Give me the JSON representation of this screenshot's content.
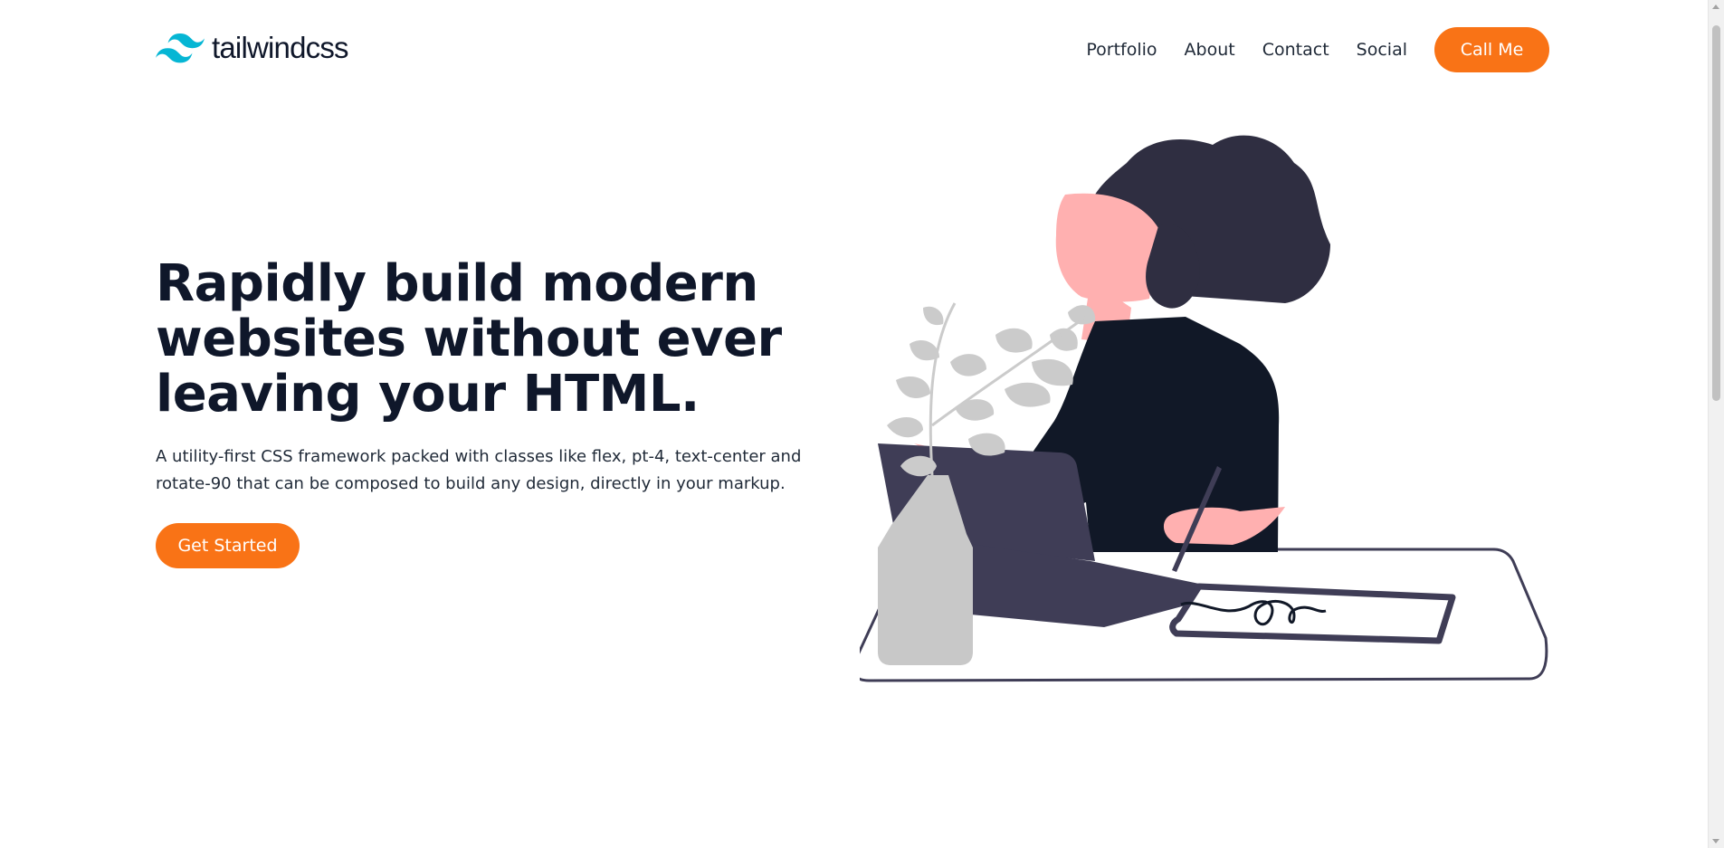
{
  "brand": {
    "name": "tailwindcss",
    "logo_icon": "tailwind-wave-logo",
    "logo_color": "#06b6d4"
  },
  "nav": {
    "links": [
      "Portfolio",
      "About",
      "Contact",
      "Social"
    ],
    "cta_label": "Call Me"
  },
  "hero": {
    "title": "Rapidly build modern websites without ever leaving your HTML.",
    "subtitle": "A utility-first CSS framework packed with classes like flex, pt-4, text-center and rotate-90 that can be composed to build any design, directly in your markup.",
    "cta_label": "Get Started"
  },
  "colors": {
    "accent": "#f97316",
    "text": "#0f172a",
    "illustration_dark": "#111827",
    "skin": "#ffb0b0"
  }
}
